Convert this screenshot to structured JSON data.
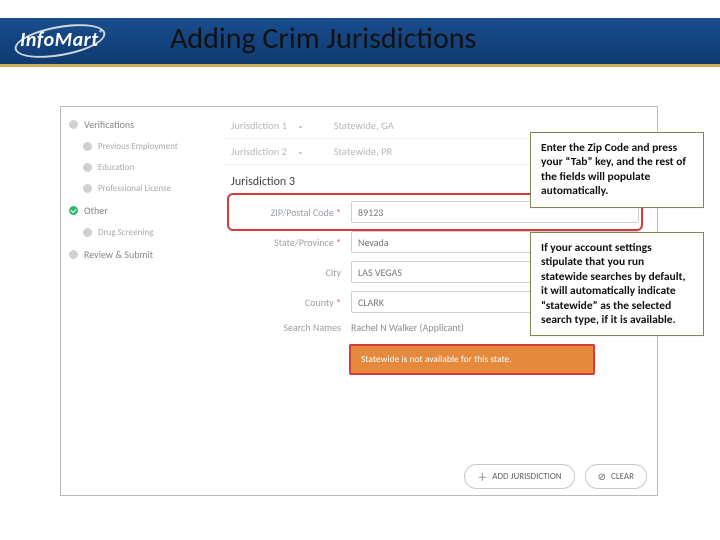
{
  "header": {
    "logo_text": "InfoMart",
    "logo_reg": "®",
    "title": "Adding Crim Jurisdictions"
  },
  "sidebar": {
    "items": [
      {
        "label": "Verifications",
        "kind": "top"
      },
      {
        "label": "Previous Employment",
        "kind": "sub"
      },
      {
        "label": "Education",
        "kind": "sub"
      },
      {
        "label": "Professional License",
        "kind": "sub"
      },
      {
        "label": "Other",
        "kind": "top-green"
      },
      {
        "label": "Drug Screening",
        "kind": "sub"
      },
      {
        "label": "Review & Submit",
        "kind": "top"
      }
    ]
  },
  "jurisdictions": {
    "j1": {
      "label": "Jurisdiction 1",
      "value": "Statewide, GA"
    },
    "j2": {
      "label": "Jurisdiction 2",
      "value": "Statewide, PR"
    },
    "j3": {
      "label": "Jurisdiction 3"
    }
  },
  "form": {
    "zip": {
      "label": "ZIP/Postal Code",
      "req": "*",
      "value": "89123"
    },
    "state": {
      "label": "State/Province",
      "req": "*",
      "value": "Nevada"
    },
    "city": {
      "label": "City",
      "value": "LAS VEGAS"
    },
    "county": {
      "label": "County",
      "req": "*",
      "value": "CLARK"
    },
    "names": {
      "label": "Search Names",
      "value": "Rachel N Walker (Applicant)"
    }
  },
  "warning": "Statewide is not available for this state.",
  "buttons": {
    "add": "ADD JURISDICTION",
    "clear": "CLEAR"
  },
  "callouts": {
    "c1": "Enter the Zip Code and press your “Tab” key, and the rest of the fields will populate automatically.",
    "c2": "If your account settings stipulate that you run statewide searches by default, it will automatically indicate “statewide” as the selected search type, if it is available."
  }
}
